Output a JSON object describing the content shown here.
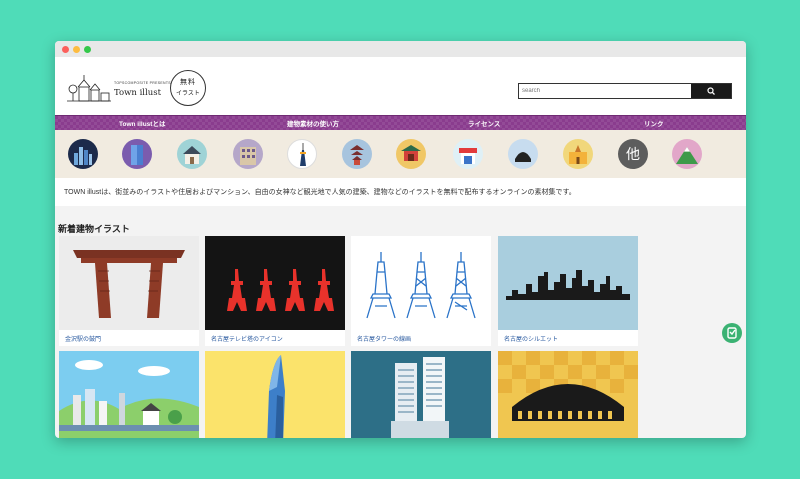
{
  "window": {
    "controls": [
      "close",
      "minimize",
      "zoom"
    ]
  },
  "header": {
    "logo_small": "TOPSCOMPOSITE PRESENTS",
    "logo_title": "Town illust",
    "badge_line1": "無料",
    "badge_line2": "イラスト",
    "search_placeholder": "search",
    "search_icon": "search-icon"
  },
  "nav": {
    "items": [
      {
        "label": "Town illustとは"
      },
      {
        "label": "建物素材の使い方"
      },
      {
        "label": "ライセンス"
      },
      {
        "label": "リンク"
      }
    ]
  },
  "categories": {
    "items": [
      {
        "icon": "city-skyline-icon",
        "color": "#1c2a4a"
      },
      {
        "icon": "office-building-icon",
        "color": "#7b5cae"
      },
      {
        "icon": "house-icon",
        "color": "#9fd3d6"
      },
      {
        "icon": "apartment-icon",
        "color": "#b5a7c9"
      },
      {
        "icon": "tower-icon",
        "color": "#ffffff"
      },
      {
        "icon": "pagoda-icon",
        "color": "#a7c4de"
      },
      {
        "icon": "shrine-icon",
        "color": "#f0c766"
      },
      {
        "icon": "shop-icon",
        "color": "#dff0f6"
      },
      {
        "icon": "dome-icon",
        "color": "#c7dcef"
      },
      {
        "icon": "school-icon",
        "color": "#f1d77b"
      },
      {
        "icon": "other-icon",
        "color": "#5d5d5d",
        "label": "他"
      },
      {
        "icon": "mountain-icon",
        "color": "#e2a7c9"
      }
    ]
  },
  "description": "TOWN illustは、街並みのイラストや住居およびマンション、自由の女神など観光地で人気の建築、建物などのイラストを無料で配布するオンラインの素材集です。",
  "section_title": "新着建物イラスト",
  "cards": [
    {
      "caption": "金沢駅の鼓門"
    },
    {
      "caption": "名古屋テレビ塔のアイコン"
    },
    {
      "caption": "名古屋タワーの線画"
    },
    {
      "caption": "名古屋のシルエット"
    },
    {
      "caption": ""
    },
    {
      "caption": ""
    },
    {
      "caption": ""
    },
    {
      "caption": ""
    }
  ],
  "colors": {
    "nav": "#8a3c8e",
    "background": "#4fdcb8",
    "caption": "#2a5aa0"
  }
}
